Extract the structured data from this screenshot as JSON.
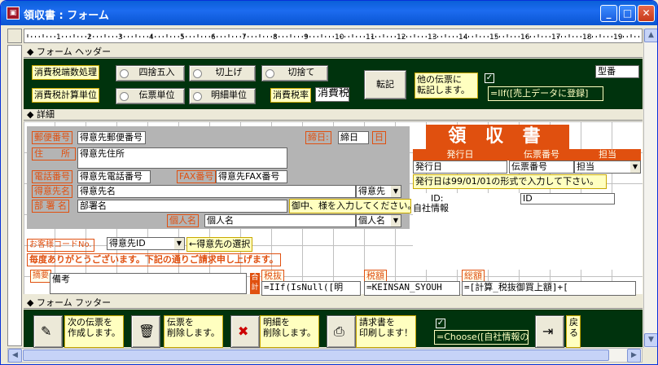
{
  "window": {
    "title": "領収書 : フォーム",
    "minimize": "_",
    "maximize": "□",
    "close": "✕"
  },
  "ruler": {
    "marks": [
      "1",
      "2",
      "3",
      "4",
      "5",
      "6",
      "7",
      "8",
      "9",
      "10",
      "11",
      "12",
      "13",
      "14",
      "15",
      "16",
      "17",
      "18",
      "19"
    ]
  },
  "sections": {
    "header": "フォーム ヘッダー",
    "detail": "詳細",
    "footer": "フォーム フッター"
  },
  "header": {
    "tax_rounding_label": "消費税端数処理",
    "tax_unit_label": "消費税計算単位",
    "opt_round": "四捨五入",
    "opt_ceil": "切上げ",
    "opt_floor": "切捨て",
    "opt_slip_unit": "伝票単位",
    "opt_detail_unit": "明細単位",
    "tax_rate_label": "消費税率",
    "tax_rate_value": "消費税",
    "transfer_button": "転記",
    "transfer_note": "他の伝票に\n転記します。",
    "transfer_check": "✓",
    "model_no": "型番",
    "expr_sales": "=IIf([売上データに登録]"
  },
  "detail": {
    "postal_label": "郵便番号",
    "postal_value": "得意先郵便番号",
    "cutoff_label": "締日:",
    "cutoff_value": "締日",
    "cutoff_unit": "日",
    "address_label": "住　　所",
    "address_value": "得意先住所",
    "phone_label": "電話番号",
    "phone_value": "得意先電話番号",
    "fax_label": "FAX番号",
    "fax_value": "得意先FAX番号",
    "customer_label": "得意先名",
    "customer_value": "得意先名",
    "customer_combo": "得意先",
    "dept_label": "部 署 名",
    "dept_value": "部署名",
    "dept_hint": "御中、様を入力してください。",
    "person_label": "個人名",
    "person_value": "個人名",
    "person_combo": "個人名",
    "receipt_title": "領 収 書",
    "issue_date_header": "発行日",
    "slip_no_header": "伝票番号",
    "staff_header": "担当",
    "issue_date_value": "発行日",
    "slip_no_value": "伝票番号",
    "staff_value": "担当",
    "date_hint": "発行日は99/01/01の形式で入力して下さい。",
    "id_label": "ID:",
    "id_value": "ID",
    "company_info": "自社情報",
    "customer_code_label": "お客様コードNo.",
    "customer_id_value": "得意先ID",
    "customer_select_hint": "←得意先の選択",
    "thanks_text": "毎度ありがとうございます。下記の通りご請求申し上げます。",
    "remarks_label": "摘要",
    "remarks_value": "備考",
    "total_label": "合計",
    "pretax_label": "税抜",
    "pretax_expr": "=IIf(IsNull([明",
    "tax_label": "税額",
    "tax_expr": "=KEINSAN_SYOUH",
    "total_amount_label": "総額",
    "total_expr": "=[計算_税抜御買上額]+["
  },
  "footer": {
    "new_slip": "次の伝票を\n作成します。",
    "delete_slip": "伝票を\n削除します。",
    "delete_detail": "明細を\n削除します。",
    "print_invoice": "請求書を\n印刷します！",
    "check": "✓",
    "choose_expr": "=Choose([自社情報の",
    "back": "戻\nる"
  }
}
